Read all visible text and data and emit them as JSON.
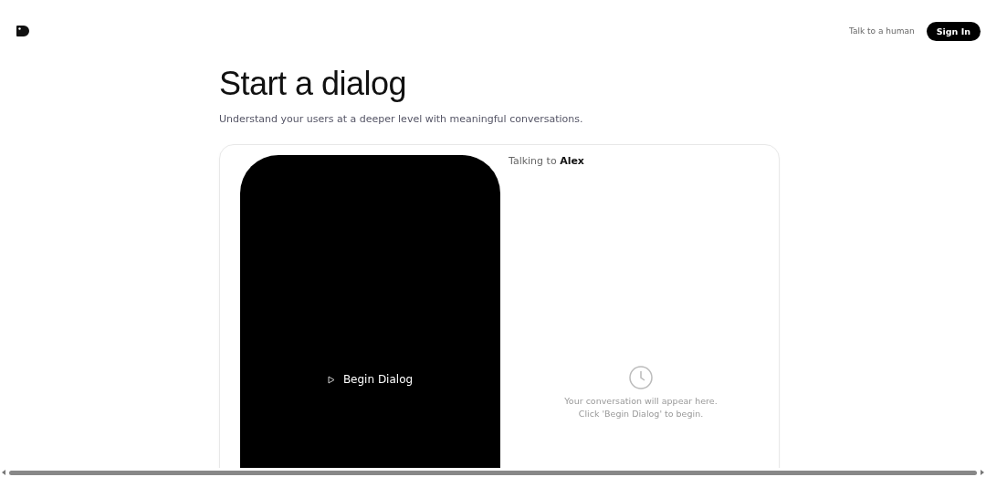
{
  "header": {
    "links": [
      "Talk to a human"
    ],
    "sign_in": "Sign In"
  },
  "hero": {
    "title": "Start a dialog",
    "subtitle": "Understand your users at a deeper level with meaningful conversations."
  },
  "demo": {
    "begin_button": "Begin Dialog",
    "talking_to_label": "Talking to",
    "talking_to_name": "Alex",
    "empty_state": [
      "Your conversation will appear here.",
      "Click 'Begin Dialog' to begin."
    ]
  }
}
